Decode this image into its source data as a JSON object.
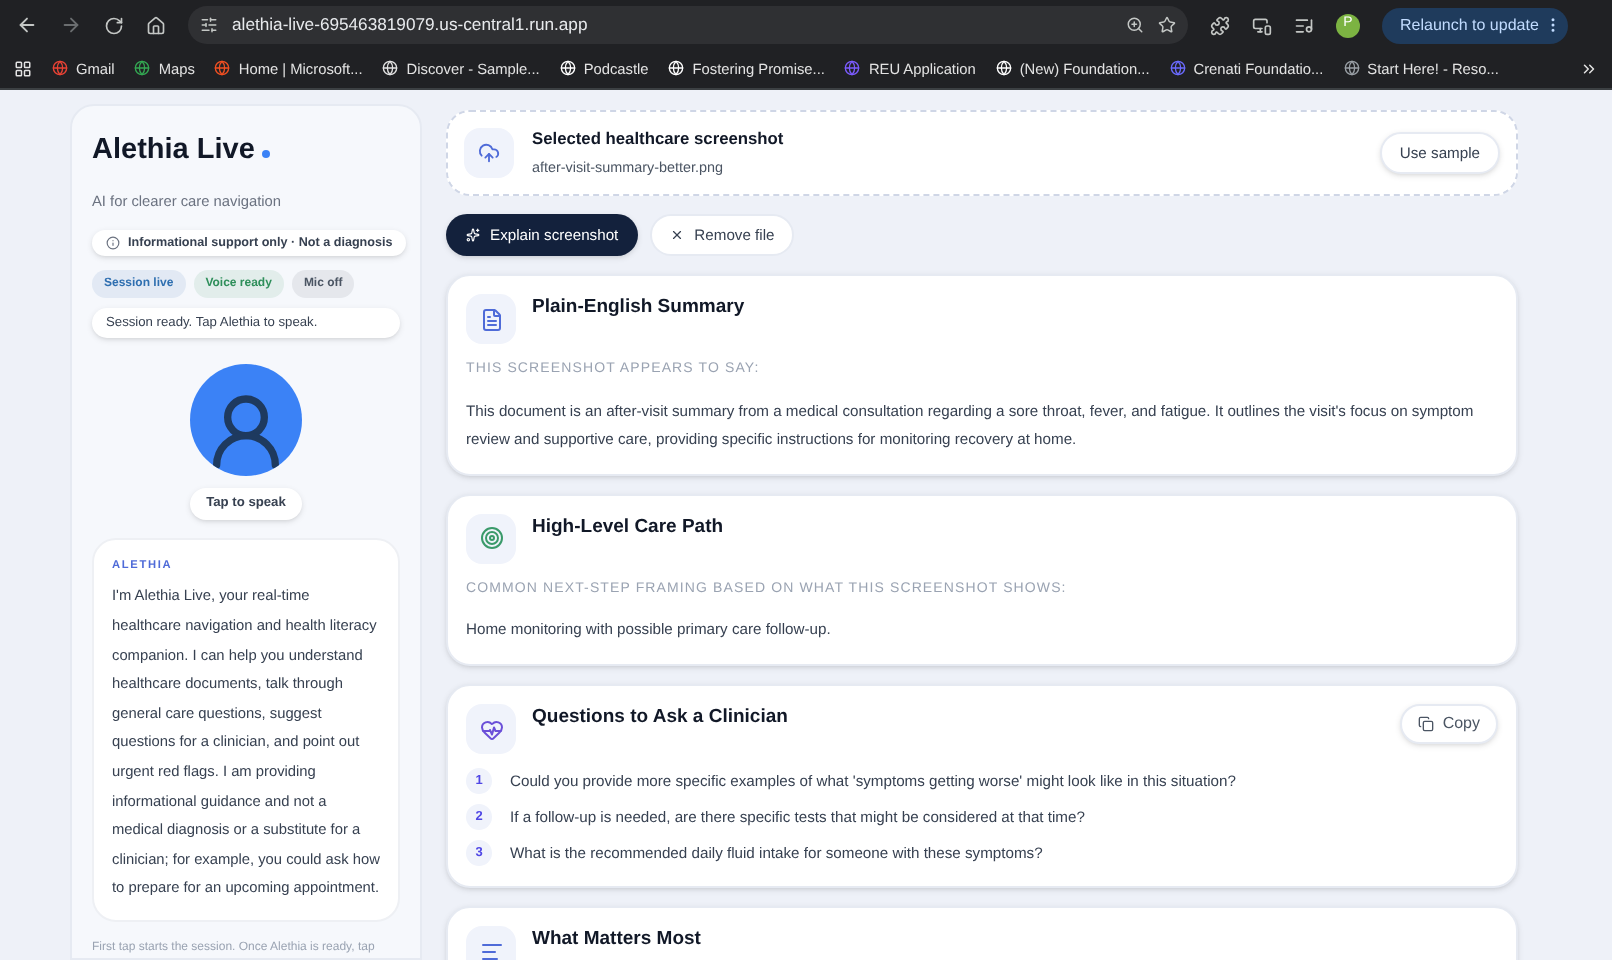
{
  "browser": {
    "url": "alethia-live-695463819079.us-central1.run.app",
    "profile_initial": "P",
    "relaunch_label": "Relaunch to update",
    "bookmarks": [
      {
        "label": "Gmail"
      },
      {
        "label": "Maps"
      },
      {
        "label": "Home | Microsoft..."
      },
      {
        "label": "Discover - Sample..."
      },
      {
        "label": "Podcastle"
      },
      {
        "label": "Fostering Promise..."
      },
      {
        "label": "REU Application"
      },
      {
        "label": "(New) Foundation..."
      },
      {
        "label": "Crenati Foundatio..."
      },
      {
        "label": "Start Here! - Reso..."
      }
    ]
  },
  "sidebar": {
    "title": "Alethia Live",
    "subtitle": "AI for clearer care navigation",
    "notice": "Informational support only · Not a diagnosis",
    "chips": [
      {
        "label": "Session live",
        "color": "#2f6fb0"
      },
      {
        "label": "Voice ready",
        "color": "#2f8f5b"
      },
      {
        "label": "Mic off",
        "color": "#4b5563"
      }
    ],
    "status": "Session ready. Tap Alethia to speak.",
    "tap_label": "Tap to speak",
    "transcript_label": "ALETHIA",
    "transcript": "I'm Alethia Live, your real-time healthcare navigation and health literacy companion. I can help you understand healthcare documents, talk through general care questions, suggest questions for a clinician, and point out urgent red flags. I am providing informational guidance and not a medical diagnosis or a substitute for a clinician; for example, you could ask how to prepare for an upcoming appointment.",
    "hint": "First tap starts the session. Once Alethia is ready, tap"
  },
  "upload": {
    "title": "Selected healthcare screenshot",
    "filename": "after-visit-summary-better.png",
    "sample_button": "Use sample"
  },
  "actions": {
    "explain": "Explain screenshot",
    "remove": "Remove file"
  },
  "cards": [
    {
      "kind": "text",
      "title": "Plain-English Summary",
      "caption": "THIS SCREENSHOT APPEARS TO SAY:",
      "body": "This document is an after-visit summary from a medical consultation regarding a sore throat, fever, and fatigue. It outlines the visit's focus on symptom review and supportive care, providing specific instructions for monitoring recovery at home."
    },
    {
      "kind": "text",
      "title": "High-Level Care Path",
      "caption": "COMMON NEXT-STEP FRAMING BASED ON WHAT THIS SCREENSHOT SHOWS:",
      "body": "Home monitoring with possible primary care follow-up."
    },
    {
      "kind": "list",
      "title": "Questions to Ask a Clinician",
      "copy": "Copy",
      "items": [
        {
          "number": "1",
          "text": "Could you provide more specific examples of what 'symptoms getting worse' might look like in this situation?"
        },
        {
          "number": "2",
          "text": "If a follow-up is needed, are there specific tests that might be considered at that time?"
        },
        {
          "number": "3",
          "text": "What is the recommended daily fluid intake for someone with these symptoms?"
        }
      ]
    },
    {
      "kind": "header",
      "title": "What Matters Most"
    }
  ]
}
